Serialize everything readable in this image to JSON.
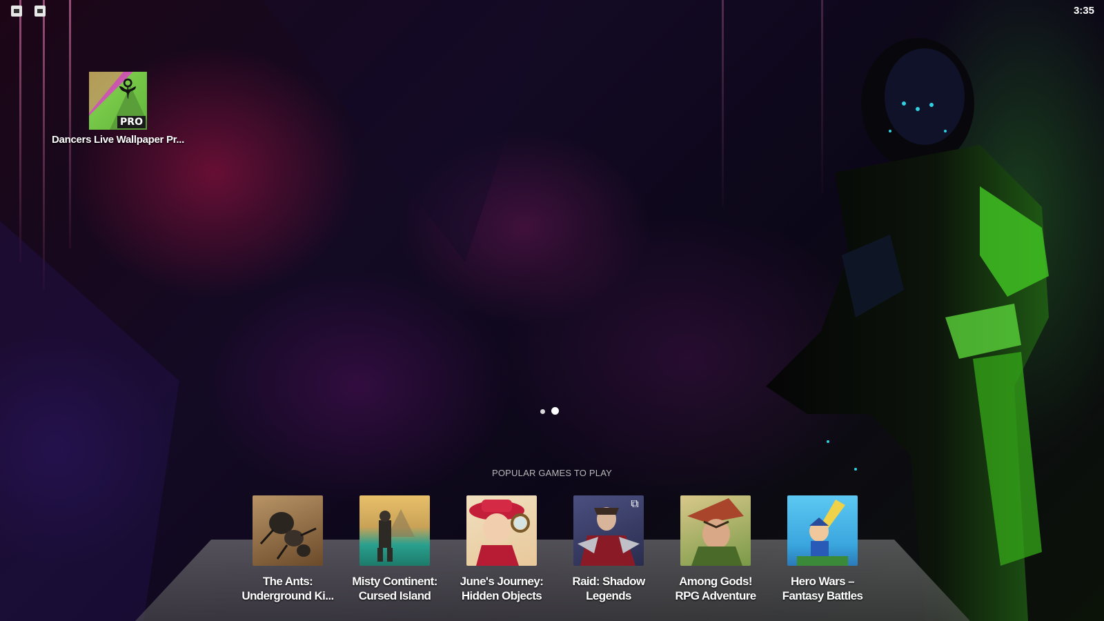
{
  "status_bar": {
    "icons": [
      "notification-icon",
      "screenshot-icon"
    ],
    "time": "3:35"
  },
  "desktop": {
    "shortcut": {
      "label": "Dancers Live Wallpaper Pr...",
      "badge": "PRO",
      "icon": "dancer-wallpaper-app-icon"
    },
    "page_indicator": {
      "pages": 2,
      "active": 2
    }
  },
  "dock": {
    "heading": "POPULAR GAMES TO PLAY",
    "games": [
      {
        "title_line1": "The Ants:",
        "title_line2": "Underground Ki...",
        "icon": "ant-game-icon",
        "colors": [
          "#a0784a",
          "#5a3c22"
        ]
      },
      {
        "title_line1": "Misty Continent:",
        "title_line2": "Cursed Island",
        "icon": "island-game-icon",
        "colors": [
          "#d9b25a",
          "#2aa08e"
        ]
      },
      {
        "title_line1": "June's Journey:",
        "title_line2": "Hidden Objects",
        "icon": "detective-lady-game-icon",
        "colors": [
          "#c41f3a",
          "#f1d9b0"
        ]
      },
      {
        "title_line1": "Raid: Shadow",
        "title_line2": "Legends",
        "icon": "warrior-game-icon",
        "colors": [
          "#3a3f6e",
          "#b0202c"
        ],
        "external_link_icon": "external-link-icon"
      },
      {
        "title_line1": "Among Gods!",
        "title_line2": "RPG Adventure",
        "icon": "archer-game-icon",
        "colors": [
          "#c9b46a",
          "#6b8a3a"
        ]
      },
      {
        "title_line1": "Hero Wars –",
        "title_line2": "Fantasy Battles",
        "icon": "hero-game-icon",
        "colors": [
          "#3fb0e6",
          "#f0c83a"
        ]
      }
    ]
  }
}
